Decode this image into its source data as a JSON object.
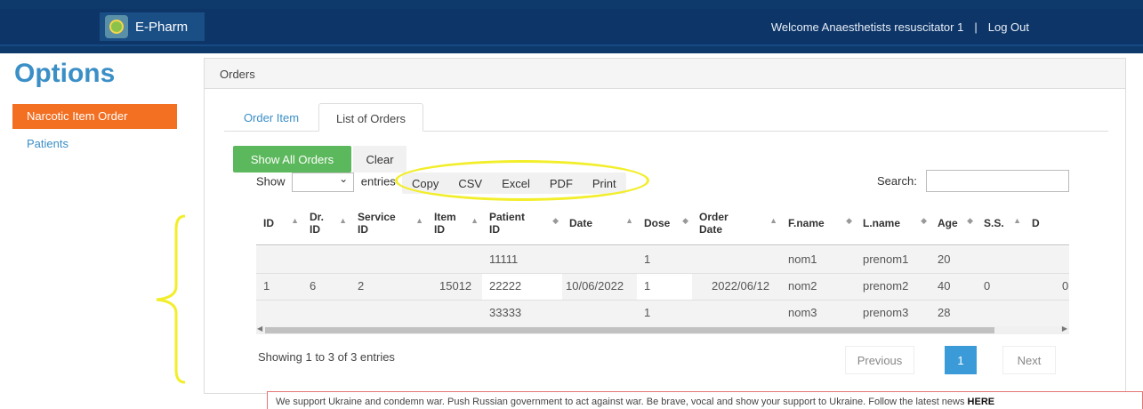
{
  "navbar": {
    "brand": "E-Pharm",
    "welcome": "Welcome Anaesthetists resuscitator 1",
    "separator": "|",
    "logout": "Log Out"
  },
  "sidebar": {
    "title": "Options",
    "items": [
      {
        "label": "Narcotic Item Order",
        "active": true
      },
      {
        "label": "Patients",
        "active": false
      }
    ]
  },
  "panel": {
    "heading": "Orders",
    "tabs": [
      {
        "label": "Order Item",
        "active": false
      },
      {
        "label": "List of Orders",
        "active": true
      }
    ],
    "buttons": {
      "show_all": "Show All Orders",
      "clear": "Clear"
    },
    "length": {
      "prefix": "Show",
      "suffix": "entries",
      "value": ""
    },
    "export": [
      "Copy",
      "CSV",
      "Excel",
      "PDF",
      "Print"
    ],
    "search": {
      "label": "Search:",
      "value": ""
    }
  },
  "table": {
    "columns": [
      {
        "l1": "ID",
        "l2": ""
      },
      {
        "l1": "Dr.",
        "l2": "ID"
      },
      {
        "l1": "Service",
        "l2": "ID"
      },
      {
        "l1": "Item",
        "l2": "ID"
      },
      {
        "l1": "Patient",
        "l2": "ID"
      },
      {
        "l1": "Date",
        "l2": ""
      },
      {
        "l1": "Dose",
        "l2": ""
      },
      {
        "l1": "Order",
        "l2": "Date"
      },
      {
        "l1": "F.name",
        "l2": ""
      },
      {
        "l1": "L.name",
        "l2": ""
      },
      {
        "l1": "Age",
        "l2": ""
      },
      {
        "l1": "S.S.",
        "l2": ""
      },
      {
        "l1": "D",
        "l2": ""
      }
    ],
    "row": {
      "id": "1",
      "dr_id": "6",
      "service_id": "2",
      "item_id": "15012",
      "date": "10/06/2022",
      "order_date": "2022/06/12",
      "ss": "0",
      "d": "0",
      "patients": [
        {
          "patient_id": "11111",
          "dose": "1",
          "fname": "nom1",
          "lname": "prenom1",
          "age": "20"
        },
        {
          "patient_id": "22222",
          "dose": "1",
          "fname": "nom2",
          "lname": "prenom2",
          "age": "40"
        },
        {
          "patient_id": "33333",
          "dose": "1",
          "fname": "nom3",
          "lname": "prenom3",
          "age": "28"
        }
      ]
    }
  },
  "footer": {
    "info": "Showing 1 to 3 of 3 entries",
    "pagination": {
      "previous": "Previous",
      "current": "1",
      "next": "Next"
    }
  },
  "banner": {
    "text": "We support Ukraine and condemn war. Push Russian government to act against war. Be brave, vocal and show your support to Ukraine. Follow the latest news",
    "link": "HERE"
  },
  "colors": {
    "navbar": "#0d3568",
    "accent": "#3b8fc7",
    "active_item": "#f36f21",
    "success": "#5cb85c",
    "annotation": "#f2ee2a"
  }
}
